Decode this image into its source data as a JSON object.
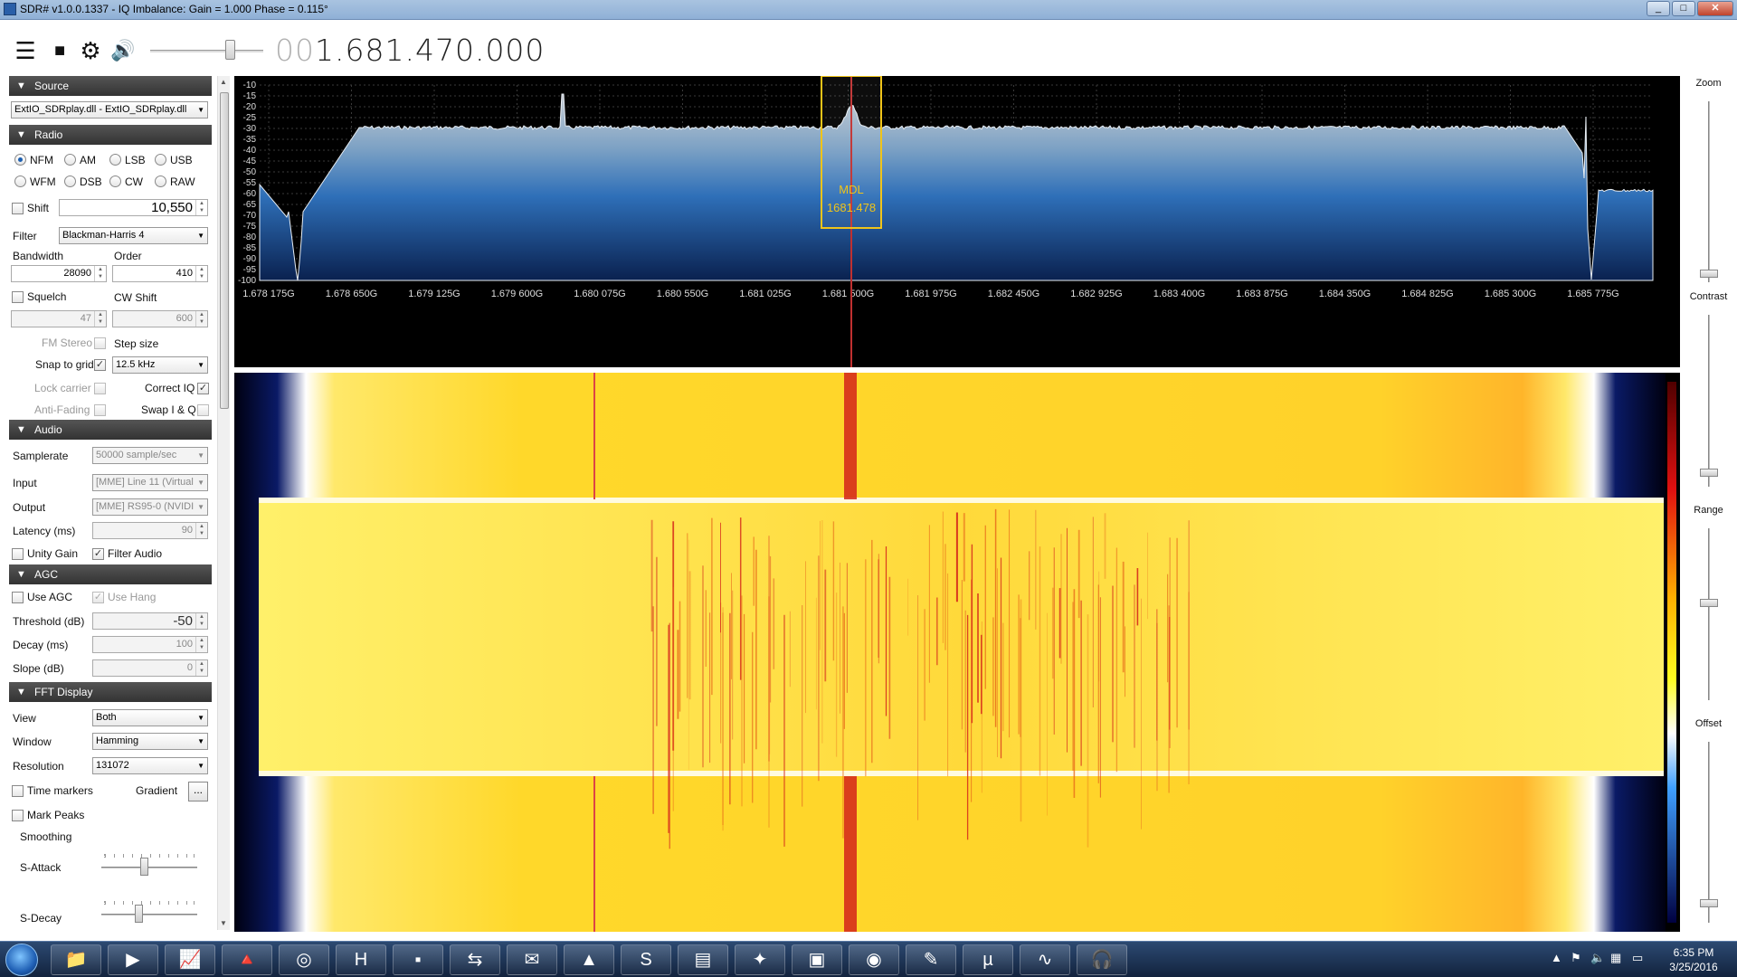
{
  "window": {
    "title": "SDR# v1.0.0.1337 - IQ Imbalance: Gain = 1.000 Phase = 0.115°"
  },
  "frequency": {
    "dim_prefix": "00",
    "value": "1.681.470.000"
  },
  "source": {
    "header": "Source",
    "device": "ExtIO_SDRplay.dll - ExtIO_SDRplay.dll"
  },
  "radio": {
    "header": "Radio",
    "modes": [
      "NFM",
      "AM",
      "LSB",
      "USB",
      "WFM",
      "DSB",
      "CW",
      "RAW"
    ],
    "selected_mode": "NFM",
    "shift_label": "Shift",
    "shift_value": "10,550",
    "filter_label": "Filter",
    "filter_value": "Blackman-Harris 4",
    "bandwidth_label": "Bandwidth",
    "bandwidth_value": "28090",
    "order_label": "Order",
    "order_value": "410",
    "squelch_label": "Squelch",
    "squelch_value": "47",
    "cwshift_label": "CW Shift",
    "cwshift_value": "600",
    "fmstereo_label": "FM Stereo",
    "stepsize_label": "Step size",
    "snap_label": "Snap to grid",
    "step_value": "12.5 kHz",
    "lockcarrier_label": "Lock carrier",
    "correctiq_label": "Correct IQ",
    "antifading_label": "Anti-Fading",
    "swapiq_label": "Swap I & Q"
  },
  "audio": {
    "header": "Audio",
    "samplerate_label": "Samplerate",
    "samplerate_value": "50000 sample/sec",
    "input_label": "Input",
    "input_value": "[MME] Line 11 (Virtual",
    "output_label": "Output",
    "output_value": "[MME] RS95-0 (NVIDI",
    "latency_label": "Latency (ms)",
    "latency_value": "90",
    "unity_label": "Unity Gain",
    "filteraudio_label": "Filter Audio"
  },
  "agc": {
    "header": "AGC",
    "useagc_label": "Use AGC",
    "usehang_label": "Use Hang",
    "threshold_label": "Threshold (dB)",
    "threshold_value": "-50",
    "decay_label": "Decay (ms)",
    "decay_value": "100",
    "slope_label": "Slope (dB)",
    "slope_value": "0"
  },
  "fft": {
    "header": "FFT Display",
    "view_label": "View",
    "view_value": "Both",
    "window_label": "Window",
    "window_value": "Hamming",
    "resolution_label": "Resolution",
    "resolution_value": "131072",
    "timemarkers_label": "Time markers",
    "gradient_label": "Gradient",
    "gradient_btn": "...",
    "markpeaks_label": "Mark Peaks",
    "smoothing_label": "Smoothing",
    "sattack_label": "S-Attack",
    "sdecay_label": "S-Decay"
  },
  "right": {
    "zoom_label": "Zoom",
    "contrast_label": "Contrast",
    "range_label": "Range",
    "offset_label": "Offset"
  },
  "chart_data": {
    "type": "line",
    "y_ticks": [
      "-10",
      "-15",
      "-20",
      "-25",
      "-30",
      "-35",
      "-40",
      "-45",
      "-50",
      "-55",
      "-60",
      "-65",
      "-70",
      "-75",
      "-80",
      "-85",
      "-90",
      "-95",
      "-100"
    ],
    "x_ticks": [
      "1.678 175G",
      "1.678 650G",
      "1.679 125G",
      "1.679 600G",
      "1.680 075G",
      "1.680 550G",
      "1.681 025G",
      "1.681 500G",
      "1.681 975G",
      "1.682 450G",
      "1.682 925G",
      "1.683 400G",
      "1.683 875G",
      "1.684 350G",
      "1.684 825G",
      "1.685 300G",
      "1.685 775G"
    ],
    "ylim": [
      -100,
      -10
    ],
    "marker": {
      "line1": "MDL",
      "line2": "1681.478"
    }
  },
  "colors": {
    "spectrum_top": "#b8c4cf",
    "spectrum_bottom": "#0b2a64",
    "marker": "#f0c419",
    "waterfall_base": "#ffe41a",
    "waterfall_signal": "#d4231a"
  },
  "clock": {
    "time": "6:35 PM",
    "date": "3/25/2016"
  },
  "taskbar_icons": [
    "folder-icon",
    "media-player-icon",
    "sdr-icon",
    "vlc-icon",
    "chrome-icon",
    "hex-editor-icon",
    "cmd-icon",
    "network-icon",
    "thunderbird-icon",
    "pdf-icon",
    "skype-icon",
    "window-icon",
    "game-icon",
    "monitor-icon",
    "disk-icon",
    "notepad-icon",
    "utorrent-icon",
    "sdrsharp-icon",
    "headset-icon"
  ]
}
